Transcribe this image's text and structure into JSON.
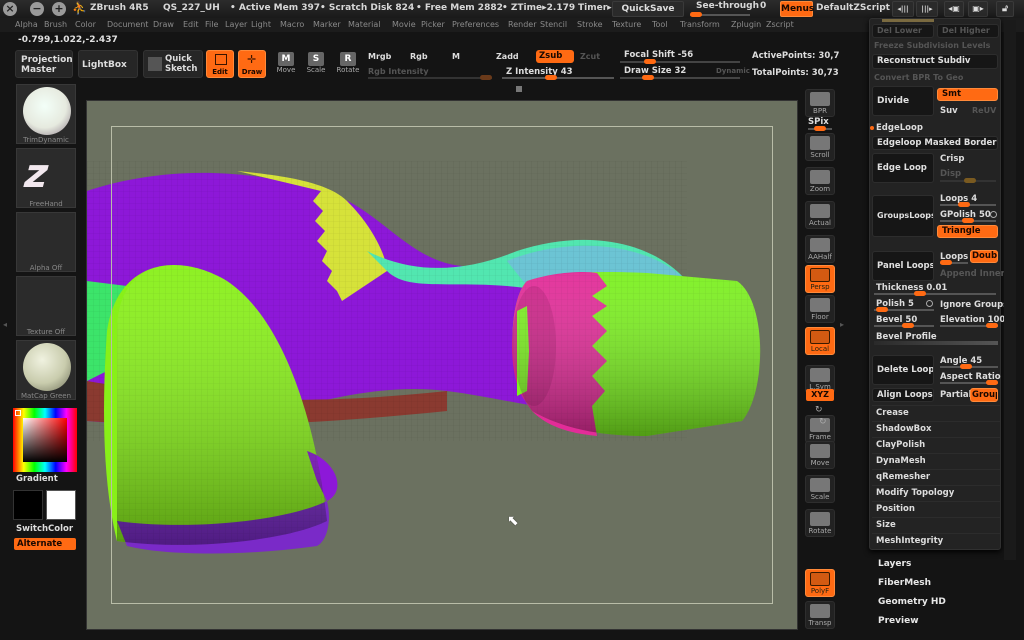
{
  "titlebar": {
    "app_name": "ZBrush 4R5",
    "doc_name": "QS_227_UH",
    "active_mem": "• Active Mem 397",
    "scratch_disk": "• Scratch Disk 824",
    "free_mem": "• Free Mem 2882",
    "ztime": "• ZTime▸2.179",
    "timer": "Timer▸",
    "quicksave": "QuickSave",
    "see_through_label": "See-through",
    "see_through_value": "0",
    "see_through_fraction": 0.0,
    "menus": "Menus",
    "default_zscript": "DefaultZScript"
  },
  "menubar": [
    "Alpha",
    "Brush",
    "Color",
    "Document",
    "Draw",
    "Edit",
    "File",
    "Layer",
    "Light",
    "Macro",
    "Marker",
    "Material",
    "Movie",
    "Picker",
    "Preferences",
    "Render",
    "Stencil",
    "Stroke",
    "Texture",
    "Tool",
    "Transform",
    "Zplugin",
    "Zscript"
  ],
  "coords": "-0.799,1.022,-2.437",
  "toolbar": {
    "projection_master": "Projection Master",
    "lightbox": "LightBox",
    "quick_sketch": "Quick Sketch",
    "edit": "Edit",
    "draw": "Draw",
    "move": "Move",
    "scale": "Scale",
    "rotate": "Rotate",
    "mrgb": "Mrgb",
    "rgb": "Rgb",
    "m": "M",
    "rgb_intensity": "Rgb Intensity",
    "zadd": "Zadd",
    "zsub": "Zsub",
    "zcut": "Zcut",
    "z_intensity": "Z Intensity 43",
    "z_intensity_value": 43,
    "focal_shift": "Focal Shift -56",
    "focal_shift_value": -56,
    "draw_size": "Draw Size 32",
    "draw_size_value": 32,
    "dynamic": "Dynamic",
    "active_points": "ActivePoints: 30,7",
    "total_points": "TotalPoints: 30,73"
  },
  "left_shelf": {
    "brush": "TrimDynamic",
    "stroke": "FreeHand",
    "alpha": "Alpha Off",
    "texture": "Texture Off",
    "material": "MatCap Green",
    "gradient": "Gradient",
    "switch_color": "SwitchColor",
    "alternate": "Alternate",
    "main_color": "#000000",
    "secondary_color": "#ffffff"
  },
  "right_shelf": [
    {
      "label": "BPR",
      "on": false
    },
    {
      "label": "SPix",
      "on": false
    },
    {
      "label": "Scroll",
      "on": false
    },
    {
      "label": "Zoom",
      "on": false
    },
    {
      "label": "Actual",
      "on": false
    },
    {
      "label": "AAHalf",
      "on": false
    },
    {
      "label": "Persp",
      "on": true
    },
    {
      "label": "Floor",
      "on": false
    },
    {
      "label": "Local",
      "on": true
    },
    {
      "label": "L.Sym",
      "on": false
    },
    {
      "label": "XYZ",
      "on": true
    },
    {
      "label": "Frame",
      "on": false
    },
    {
      "label": "Move",
      "on": false
    },
    {
      "label": "Scale",
      "on": false
    },
    {
      "label": "Rotate",
      "on": false
    },
    {
      "label": "PolyF",
      "on": true
    },
    {
      "label": "Transp",
      "on": false
    }
  ],
  "panel": {
    "del_lower": "Del Lower",
    "del_higher": "Del Higher",
    "freeze_subdiv": "Freeze Subdivision Levels",
    "reconstruct_subdiv": "Reconstruct Subdiv",
    "convert_bpr": "Convert BPR To Geo",
    "divide": "Divide",
    "smt": "Smt",
    "suv": "Suv",
    "reuv": "ReUV",
    "edgeloop_header": "EdgeLoop",
    "edgeloop_masked": "Edgeloop Masked Border",
    "edge_loop": "Edge Loop",
    "crisp": "Crisp",
    "disp": "Disp",
    "groups_loops": "GroupsLoops",
    "loops4": "Loops 4",
    "gpolish": "GPolish 50",
    "triangle": "Triangle",
    "panel_loops": "Panel Loops",
    "loops": "Loops",
    "double": "Double",
    "append_inner": "Append Inner",
    "thickness": "Thickness 0.01",
    "polish": "Polish 5",
    "ignore_groups": "Ignore Groups",
    "bevel": "Bevel 50",
    "elevation": "Elevation 100",
    "bevel_profile": "Bevel Profile",
    "delete_loops": "Delete Loops",
    "angle": "Angle 45",
    "aspect_ratio": "Aspect Ratio",
    "align_loops": "Align Loops",
    "partial": "Partial",
    "groups": "Groups",
    "sections": [
      "Crease",
      "ShadowBox",
      "ClayPolish",
      "DynaMesh",
      "qRemesher",
      "Modify Topology",
      "Position",
      "Size",
      "MeshIntegrity"
    ]
  },
  "subpalettes": [
    "Layers",
    "FiberMesh",
    "Geometry HD",
    "Preview"
  ]
}
